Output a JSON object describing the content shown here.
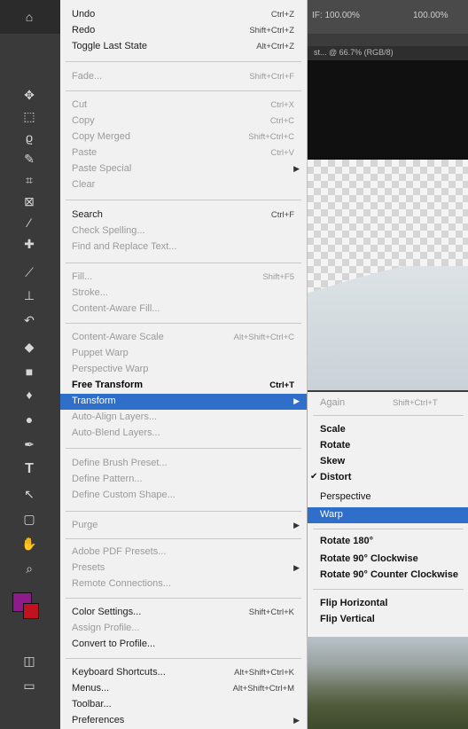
{
  "options_bar": {
    "left_value": "IF: 100.00%",
    "right_value": "100.00%"
  },
  "document_tab": {
    "label": "st... @ 66.7% (RGB/8)"
  },
  "edit_menu": {
    "items": [
      {
        "label": "Undo",
        "shortcut": "Ctrl+Z",
        "state": "normal"
      },
      {
        "label": "Redo",
        "shortcut": "Shift+Ctrl+Z",
        "state": "normal"
      },
      {
        "label": "Toggle Last State",
        "shortcut": "Alt+Ctrl+Z",
        "state": "normal"
      },
      {
        "label": "Fade...",
        "shortcut": "Shift+Ctrl+F",
        "state": "dim"
      },
      {
        "label": "Cut",
        "shortcut": "Ctrl+X",
        "state": "dim"
      },
      {
        "label": "Copy",
        "shortcut": "Ctrl+C",
        "state": "dim"
      },
      {
        "label": "Copy Merged",
        "shortcut": "Shift+Ctrl+C",
        "state": "dim"
      },
      {
        "label": "Paste",
        "shortcut": "Ctrl+V",
        "state": "dim"
      },
      {
        "label": "Paste Special",
        "shortcut": "",
        "state": "dim"
      },
      {
        "label": "Clear",
        "shortcut": "",
        "state": "dim"
      },
      {
        "label": "Search",
        "shortcut": "Ctrl+F",
        "state": "normal"
      },
      {
        "label": "Check Spelling...",
        "shortcut": "",
        "state": "dim"
      },
      {
        "label": "Find and Replace Text...",
        "shortcut": "",
        "state": "dim"
      },
      {
        "label": "Fill...",
        "shortcut": "Shift+F5",
        "state": "dim"
      },
      {
        "label": "Stroke...",
        "shortcut": "",
        "state": "dim"
      },
      {
        "label": "Content-Aware Fill...",
        "shortcut": "",
        "state": "dim"
      },
      {
        "label": "Content-Aware Scale",
        "shortcut": "Alt+Shift+Ctrl+C",
        "state": "dim"
      },
      {
        "label": "Puppet Warp",
        "shortcut": "",
        "state": "dim"
      },
      {
        "label": "Perspective Warp",
        "shortcut": "",
        "state": "dim"
      },
      {
        "label": "Free Transform",
        "shortcut": "Ctrl+T",
        "state": "bold"
      },
      {
        "label": "Transform",
        "shortcut": "",
        "state": "highlight"
      },
      {
        "label": "Auto-Align Layers...",
        "shortcut": "",
        "state": "dim"
      },
      {
        "label": "Auto-Blend Layers...",
        "shortcut": "",
        "state": "dim"
      },
      {
        "label": "Define Brush Preset...",
        "shortcut": "",
        "state": "dim"
      },
      {
        "label": "Define Pattern...",
        "shortcut": "",
        "state": "dim"
      },
      {
        "label": "Define Custom Shape...",
        "shortcut": "",
        "state": "dim"
      },
      {
        "label": "Purge",
        "shortcut": "",
        "state": "dim"
      },
      {
        "label": "Adobe PDF Presets...",
        "shortcut": "",
        "state": "dim"
      },
      {
        "label": "Presets",
        "shortcut": "",
        "state": "dim"
      },
      {
        "label": "Remote Connections...",
        "shortcut": "",
        "state": "dim"
      },
      {
        "label": "Color Settings...",
        "shortcut": "Shift+Ctrl+K",
        "state": "normal"
      },
      {
        "label": "Assign Profile...",
        "shortcut": "",
        "state": "dim"
      },
      {
        "label": "Convert to Profile...",
        "shortcut": "",
        "state": "normal"
      },
      {
        "label": "Keyboard Shortcuts...",
        "shortcut": "Alt+Shift+Ctrl+K",
        "state": "normal"
      },
      {
        "label": "Menus...",
        "shortcut": "Alt+Shift+Ctrl+M",
        "state": "normal"
      },
      {
        "label": "Toolbar...",
        "shortcut": "",
        "state": "normal"
      },
      {
        "label": "Preferences",
        "shortcut": "",
        "state": "normal"
      }
    ]
  },
  "transform_submenu": {
    "items": [
      {
        "label": "Again",
        "shortcut": "Shift+Ctrl+T",
        "state": "dim"
      },
      {
        "label": "Scale",
        "state": "bold"
      },
      {
        "label": "Rotate",
        "state": "bold"
      },
      {
        "label": "Skew",
        "state": "bold"
      },
      {
        "label": "Distort",
        "state": "bold-checked"
      },
      {
        "label": "Perspective",
        "state": "normal"
      },
      {
        "label": "Warp",
        "state": "highlight"
      },
      {
        "label": "Rotate 180°",
        "state": "bold"
      },
      {
        "label": "Rotate 90° Clockwise",
        "state": "bold"
      },
      {
        "label": "Rotate 90° Counter Clockwise",
        "state": "bold"
      },
      {
        "label": "Flip Horizontal",
        "state": "bold"
      },
      {
        "label": "Flip Vertical",
        "state": "bold"
      }
    ]
  },
  "tools": [
    "move-icon",
    "marquee-icon",
    "lasso-icon",
    "quick-select-icon",
    "crop-icon",
    "frame-icon",
    "eyedropper-icon",
    "healing-icon",
    "brush-icon",
    "clone-stamp-icon",
    "history-brush-icon",
    "eraser-icon",
    "gradient-icon",
    "blur-icon",
    "dodge-icon",
    "pen-icon",
    "type-icon",
    "path-select-icon",
    "shape-icon",
    "hand-icon",
    "zoom-icon"
  ]
}
